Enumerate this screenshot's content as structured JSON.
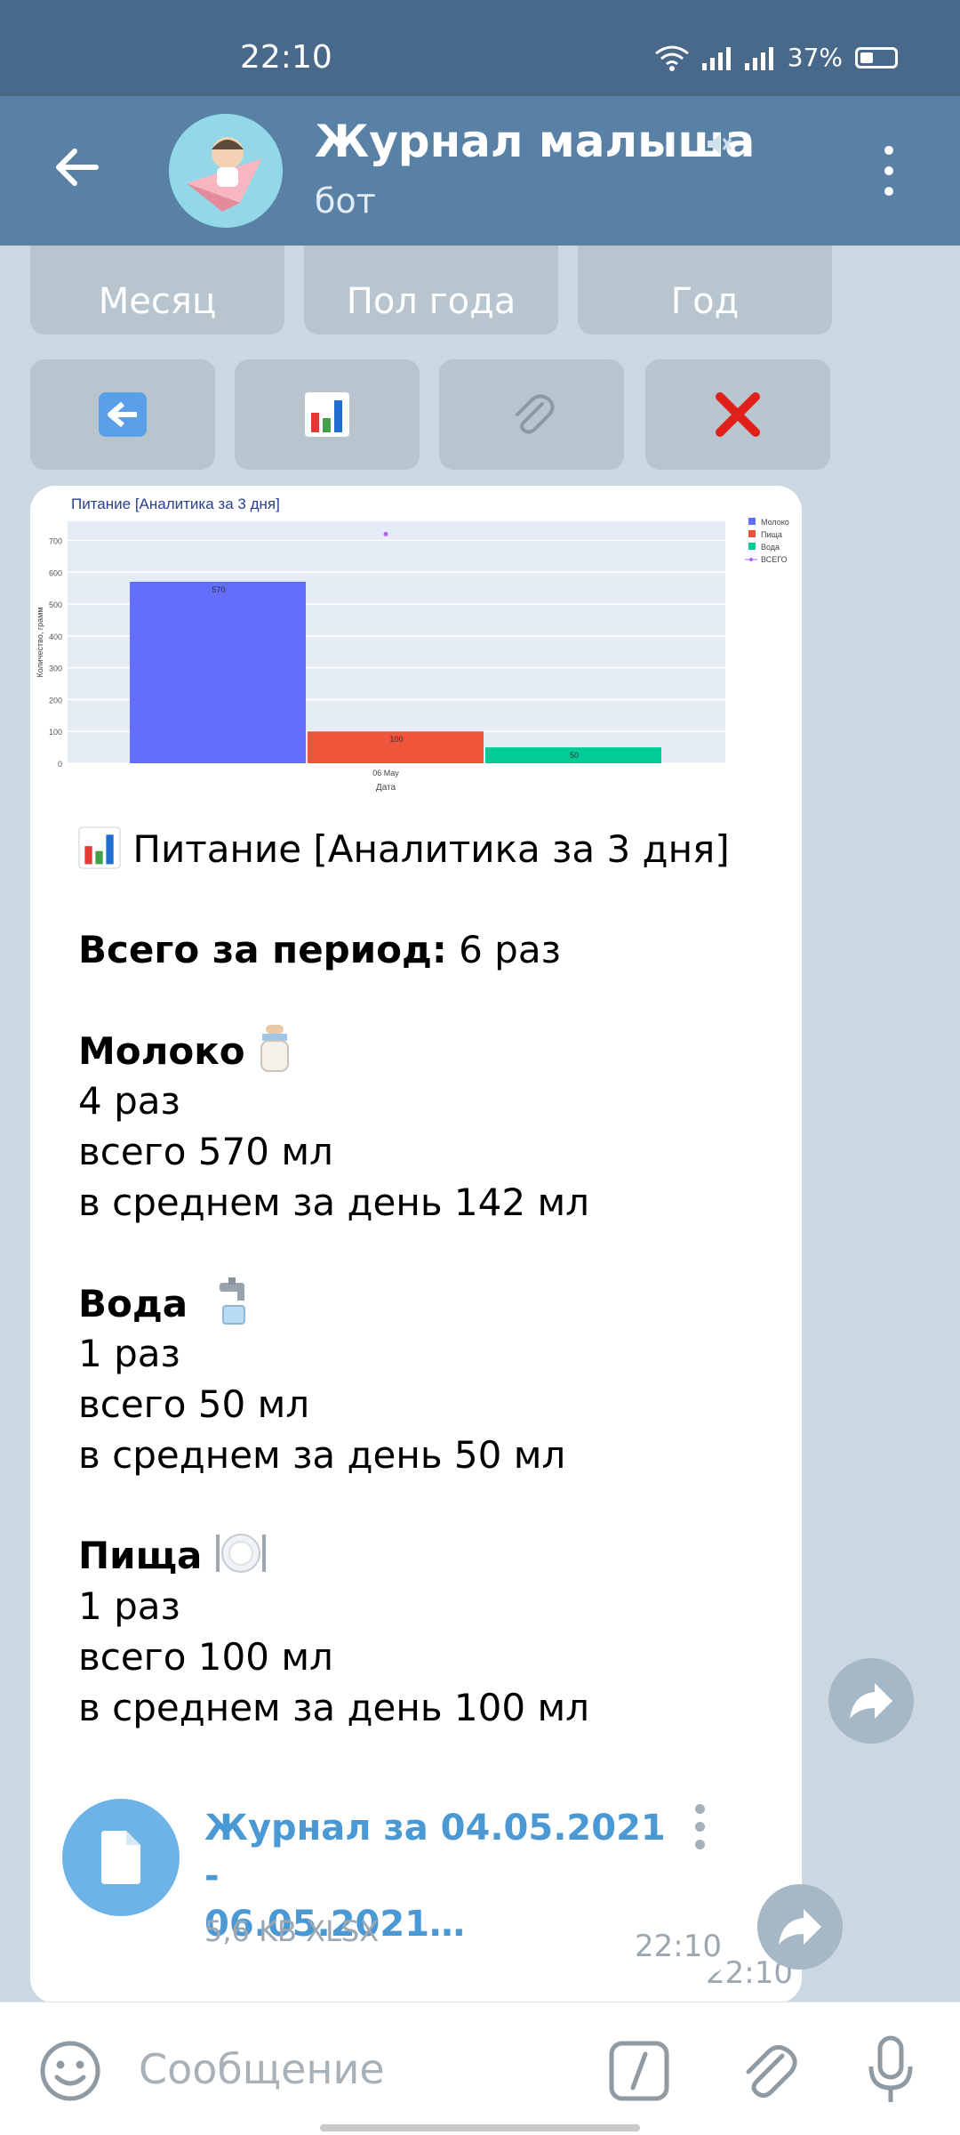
{
  "status_bar": {
    "time": "22:10",
    "battery": "37%"
  },
  "header": {
    "title": "Журнал малыша",
    "subtitle": "бот"
  },
  "keyboard": {
    "row1": [
      "Месяц",
      "Пол года",
      "Год"
    ],
    "row2_icons": [
      "back-emoji-icon",
      "bar-chart-icon",
      "paperclip-icon",
      "red-cross-icon"
    ]
  },
  "message": {
    "heading_emoji": "bar-chart-icon",
    "heading": "Питание [Аналитика за 3 дня]",
    "total_label": "Всего за период:",
    "total_value": " 6 раз",
    "sections": [
      {
        "name": "Молоко",
        "icon": "baby-bottle-icon",
        "count": "4 раз",
        "total": "всего 570 мл",
        "avg": "в среднем за день 142 мл"
      },
      {
        "name": "Вода",
        "icon": "water-tap-icon",
        "count": "1 раз",
        "total": "всего 50 мл",
        "avg": "в среднем за день 50 мл"
      },
      {
        "name": "Пища",
        "icon": "plate-icon",
        "count": "1 раз",
        "total": "всего 100 мл",
        "avg": "в среднем за день 100 мл"
      }
    ],
    "time": "22:10"
  },
  "chart_data": {
    "type": "bar",
    "title": "Питание [Аналитика за 3 дня]",
    "xlabel": "Дата",
    "ylabel": "Количество, грамм",
    "categories": [
      "06 May"
    ],
    "ylim": [
      0,
      760
    ],
    "yticks": [
      0,
      100,
      200,
      300,
      400,
      500,
      600,
      700
    ],
    "series": [
      {
        "name": "Молоко",
        "values": [
          570
        ],
        "label": "570",
        "color": "#636efa"
      },
      {
        "name": "Пища",
        "values": [
          100
        ],
        "label": "100",
        "color": "#ef553b"
      },
      {
        "name": "Вода",
        "values": [
          50
        ],
        "label": "50",
        "color": "#00cc96"
      },
      {
        "name": "ВСЕГО",
        "values": [
          720
        ],
        "color": "#ab63fa",
        "mode": "markers"
      }
    ],
    "legend": "top-right",
    "grid": true
  },
  "file_message": {
    "name_line1": "Журнал за 04.05.2021 -",
    "name_line2": "06.05.2021…",
    "meta": "5,6 KB XLSX",
    "time": "22:10"
  },
  "input": {
    "placeholder": "Сообщение"
  }
}
